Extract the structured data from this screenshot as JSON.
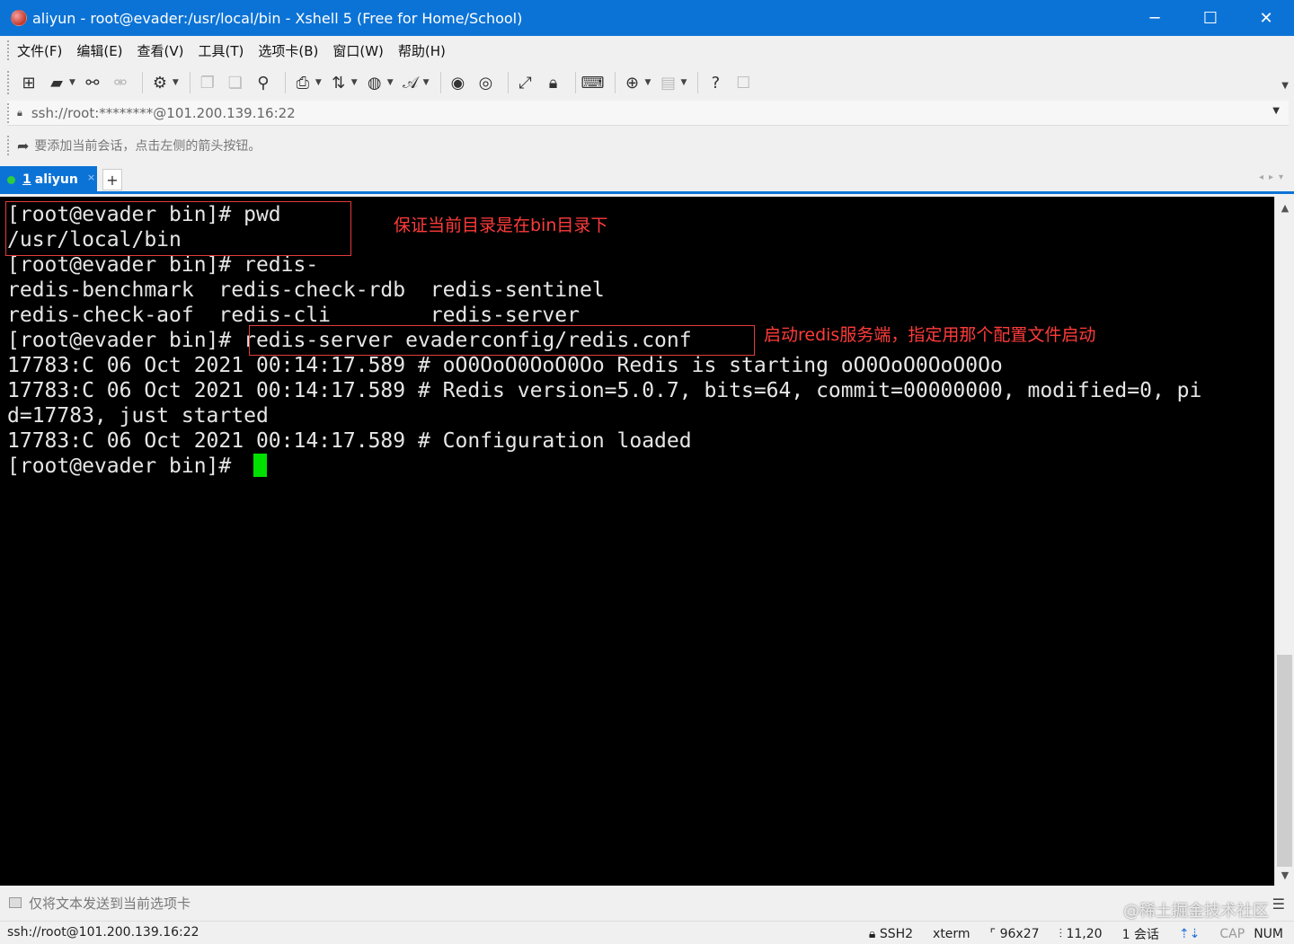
{
  "window": {
    "title": "aliyun - root@evader:/usr/local/bin - Xshell 5 (Free for Home/School)",
    "buttons": {
      "minimize": "─",
      "maximize": "☐",
      "close": "✕"
    }
  },
  "menu": [
    "文件(F)",
    "编辑(E)",
    "查看(V)",
    "工具(T)",
    "选项卡(B)",
    "窗口(W)",
    "帮助(H)"
  ],
  "toolbar_icons": [
    "new-session-icon",
    "open-folder-icon",
    "reconnect-icon",
    "disconnect-icon",
    "properties-icon",
    "copy-icon",
    "paste-icon",
    "find-icon",
    "print-icon",
    "transfer-icon",
    "globe-icon",
    "font-icon",
    "xftp-icon",
    "xmanager-icon",
    "fullscreen-icon",
    "lock-icon",
    "keyboard-icon",
    "add-icon",
    "layout-icon",
    "help-icon",
    "chat-icon"
  ],
  "address": {
    "value": "ssh://root:********@101.200.139.16:22"
  },
  "hint": {
    "text": "要添加当前会话，点击左侧的箭头按钮。"
  },
  "tab": {
    "number": "1",
    "name": "aliyun",
    "close": "×",
    "add": "+"
  },
  "terminal": {
    "lines": [
      "[root@evader bin]# pwd",
      "/usr/local/bin",
      "[root@evader bin]# redis-",
      "redis-benchmark  redis-check-rdb  redis-sentinel",
      "redis-check-aof  redis-cli        redis-server",
      "[root@evader bin]# redis-server evaderconfig/redis.conf",
      "17783:C 06 Oct 2021 00:14:17.589 # oO0OoO0OoO0Oo Redis is starting oO0OoO0OoO0Oo",
      "17783:C 06 Oct 2021 00:14:17.589 # Redis version=5.0.7, bits=64, commit=00000000, modified=0, pi",
      "d=17783, just started",
      "17783:C 06 Oct 2021 00:14:17.589 # Configuration loaded",
      "[root@evader bin]# "
    ],
    "annotations": {
      "pwd_note": "保证当前目录是在bin目录下",
      "server_note": "启动redis服务端，指定用那个配置文件启动"
    },
    "cursor_color": "#00e000"
  },
  "compose": {
    "text": "仅将文本发送到当前选项卡"
  },
  "status": {
    "connection": "ssh://root@101.200.139.16:22",
    "protocol": "SSH2",
    "term": "xterm",
    "size": "96x27",
    "position": "11,20",
    "sessions": "1 会话",
    "cap": "CAP",
    "num": "NUM"
  },
  "watermark": "@稀土掘金技术社区",
  "colors": {
    "accent": "#0c73d6",
    "annotation": "#ff3b3b",
    "terminal_bg": "#000000"
  }
}
